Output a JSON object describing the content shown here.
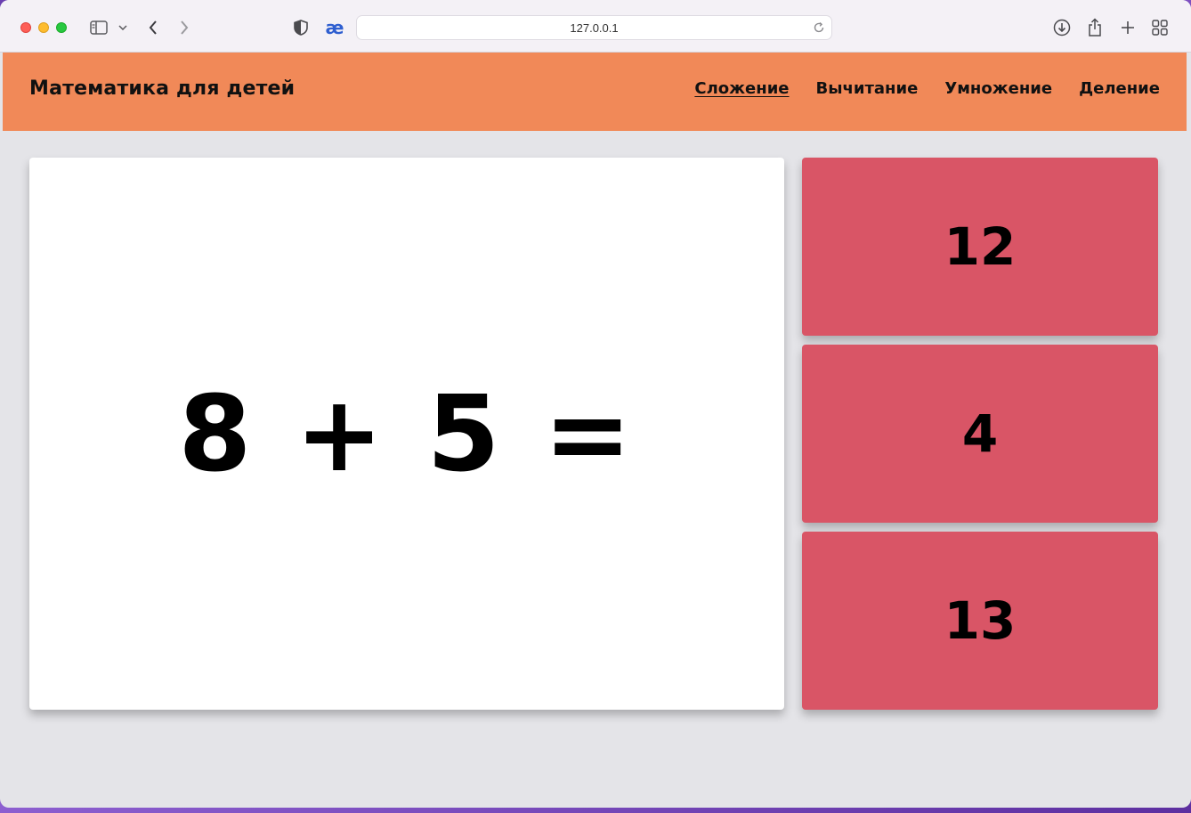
{
  "browser": {
    "url": "127.0.0.1",
    "icons": [
      "sidebar-icon",
      "chevron-down-icon",
      "back-icon",
      "forward-icon",
      "shield-icon",
      "ae-extension-icon",
      "reload-icon",
      "download-icon",
      "share-icon",
      "new-tab-icon",
      "tab-overview-icon"
    ],
    "extension_glyph": "æ"
  },
  "header": {
    "title": "Математика для детей",
    "nav": [
      {
        "label": "Сложение",
        "active": true
      },
      {
        "label": "Вычитание",
        "active": false
      },
      {
        "label": "Умножение",
        "active": false
      },
      {
        "label": "Деление",
        "active": false
      }
    ]
  },
  "quiz": {
    "question": "8 + 5 =",
    "answers": [
      "12",
      "4",
      "13"
    ]
  },
  "colors": {
    "header_bg": "#f18958",
    "answer_bg": "#d95566",
    "page_bg": "#e4e4e8"
  }
}
